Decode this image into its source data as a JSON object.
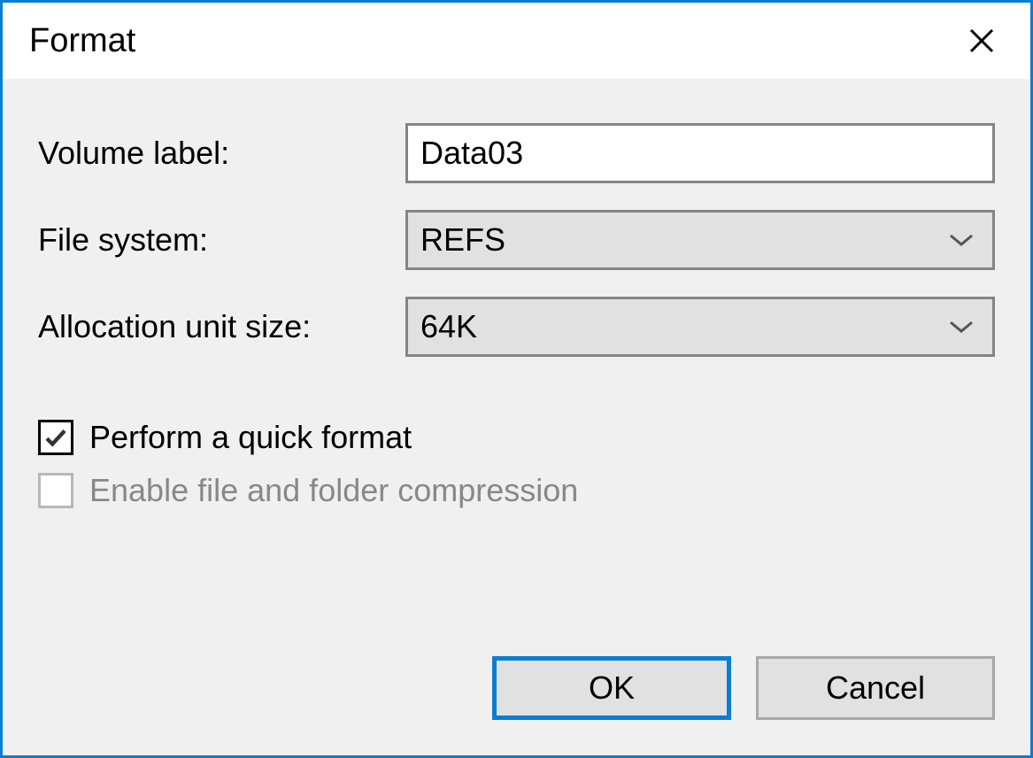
{
  "dialog": {
    "title": "Format"
  },
  "fields": {
    "volume_label": {
      "label": "Volume label:",
      "value": "Data03"
    },
    "file_system": {
      "label": "File system:",
      "value": "REFS"
    },
    "allocation_unit_size": {
      "label": "Allocation unit size:",
      "value": "64K"
    }
  },
  "checkboxes": {
    "quick_format": {
      "label": "Perform a quick format",
      "checked": true,
      "enabled": true
    },
    "compression": {
      "label": "Enable file and folder compression",
      "checked": false,
      "enabled": false
    }
  },
  "buttons": {
    "ok": "OK",
    "cancel": "Cancel"
  }
}
